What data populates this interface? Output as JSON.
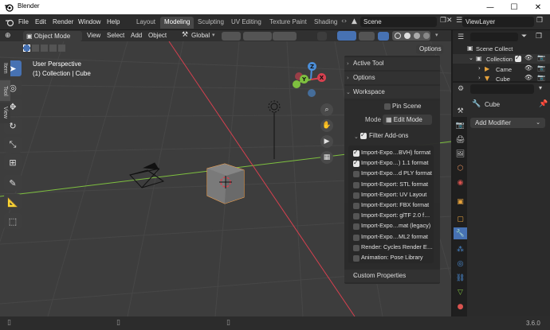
{
  "window": {
    "title": "Blender",
    "minimize": "—",
    "maximize": "☐",
    "close": "✕"
  },
  "menu": [
    "File",
    "Edit",
    "Render",
    "Window",
    "Help"
  ],
  "workspace_tabs": [
    {
      "label": "Layout"
    },
    {
      "label": "Modeling",
      "active": true
    },
    {
      "label": "Sculpting"
    },
    {
      "label": "UV Editing"
    },
    {
      "label": "Texture Paint"
    },
    {
      "label": "Shading"
    }
  ],
  "scene": {
    "name": "Scene",
    "view_layer": "ViewLayer"
  },
  "viewport_header": {
    "mode": "Object Mode",
    "menus": [
      "View",
      "Select",
      "Add",
      "Object"
    ],
    "orientation": "Global",
    "options": "Options"
  },
  "viewport": {
    "perspective": "User Perspective",
    "context": "(1) Collection | Cube",
    "gizmo": {
      "x": "X",
      "y": "Y",
      "z": "Z"
    }
  },
  "npanel": {
    "sections": {
      "active_tool": "Active Tool",
      "options": "Options",
      "workspace": "Workspace",
      "custom_properties": "Custom Properties"
    },
    "pin_scene": "Pin Scene",
    "mode_label": "Mode",
    "mode_value": "Edit Mode",
    "filter_addons": "Filter Add-ons",
    "addons": [
      {
        "label": "Import-Expo…BVH) format",
        "checked": true
      },
      {
        "label": "Import-Expo…) 1.1 format",
        "checked": true
      },
      {
        "label": "Import-Expo…d PLY format",
        "checked": false
      },
      {
        "label": "Import-Export: STL format",
        "checked": false
      },
      {
        "label": "Import-Export: UV Layout",
        "checked": false
      },
      {
        "label": "Import-Export: FBX format",
        "checked": false
      },
      {
        "label": "Import-Export: glTF 2.0 f…",
        "checked": false
      },
      {
        "label": "Import-Expo…mat (legacy)",
        "checked": false
      },
      {
        "label": "Import-Expo…ML2 format",
        "checked": false
      },
      {
        "label": "Render: Cycles Render E…",
        "checked": false
      },
      {
        "label": "Animation: Pose Library",
        "checked": false
      }
    ],
    "tabs": [
      "Item",
      "Tool",
      "View"
    ]
  },
  "outliner": {
    "scene_collection": "Scene Collect",
    "collection": "Collection",
    "items": [
      "Came",
      "Cube"
    ]
  },
  "properties": {
    "object_name": "Cube",
    "add_modifier": "Add Modifier"
  },
  "status": {
    "version": "3.6.0"
  },
  "colors": {
    "accent": "#4772b3",
    "x_axis": "#d6404f",
    "y_axis": "#7ec03f",
    "z_axis": "#4b8ed8"
  }
}
